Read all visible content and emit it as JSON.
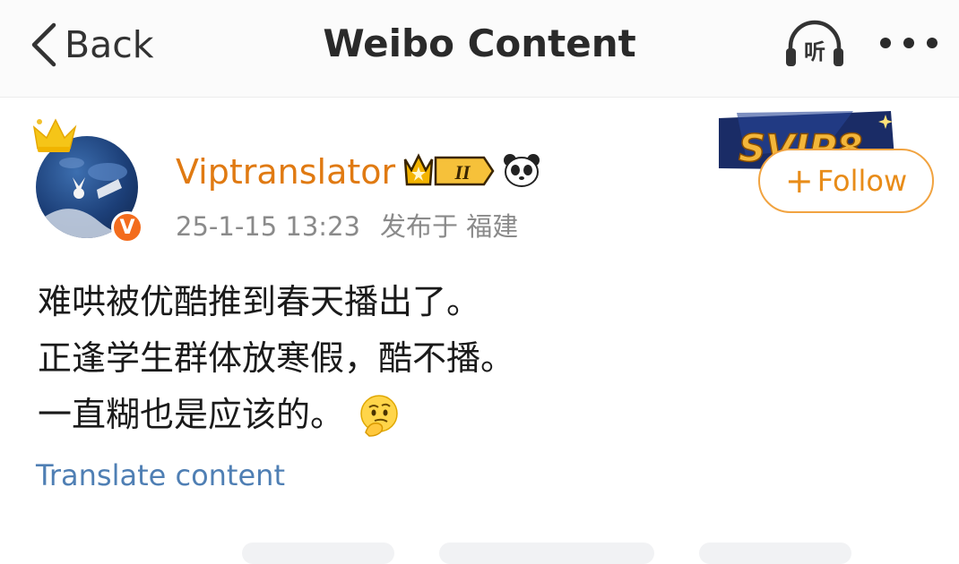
{
  "navbar": {
    "back_label": "Back",
    "title": "Weibo Content",
    "listen_icon_text": "听",
    "more_icon": "more-dots-icon"
  },
  "post": {
    "username": "Viptranslator",
    "vip_level": "II",
    "verified_badge": "V",
    "timestamp": "25-1-15 13:23",
    "location": "发布于 福建",
    "svip_badge": "SVIP8",
    "follow_label": "Follow",
    "follow_plus": "+",
    "lines": [
      "难哄被优酷推到春天播出了。",
      "正逢学生群体放寒假，酷不播。",
      "一直糊也是应该的。"
    ],
    "translate_label": "Translate content"
  },
  "colors": {
    "username": "#e07a12",
    "follow": "#e88c19",
    "link": "#4f7fb4",
    "meta": "#8a8a8a"
  }
}
